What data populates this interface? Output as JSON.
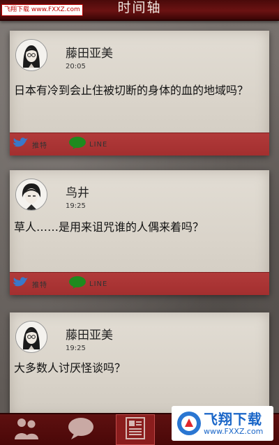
{
  "header": {
    "title": "时间轴"
  },
  "watermark_top": "飞翔下载 www.FXXZ.com",
  "posts": [
    {
      "name": "藤田亚美",
      "time": "20:05",
      "message": "日本有冷到会止住被切断的身体的血的地域吗？",
      "share_twitter": "推特",
      "share_line": "LINE"
    },
    {
      "name": "鸟井",
      "time": "19:25",
      "message": "草人……是用来诅咒谁的人偶来着吗？",
      "share_twitter": "推特",
      "share_line": "LINE"
    },
    {
      "name": "藤田亚美",
      "time": "19:25",
      "message": "大多数人讨厌怪谈吗？"
    }
  ],
  "watermark_br": {
    "text": "飞翔下载",
    "url": "www.FXXZ.com"
  },
  "colors": {
    "header": "#6b1212",
    "card": "#dcd6cc",
    "actionbar": "#a83434",
    "twitter": "#3a78c9",
    "line": "#1e8a1e"
  },
  "icons": [
    "people-icon",
    "chat-bubble-icon",
    "timeline-icon"
  ]
}
